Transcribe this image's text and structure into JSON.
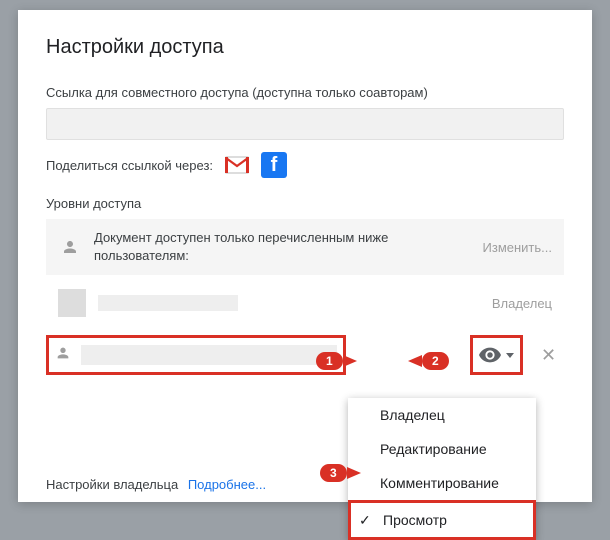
{
  "title": "Настройки доступа",
  "link_label": "Ссылка для совместного доступа (доступна только соавторам)",
  "share_via": "Поделиться ссылкой через:",
  "access_levels": "Уровни доступа",
  "private_text": "Документ доступен только перечисленным ниже пользователям:",
  "change": "Изменить...",
  "owner": "Владелец",
  "dropdown": {
    "owner": "Владелец",
    "edit": "Редактирование",
    "comment": "Комментирование",
    "view": "Просмотр"
  },
  "footer_label": "Настройки владельца",
  "footer_more": "Подробнее...",
  "callouts": {
    "c1": "1",
    "c2": "2",
    "c3": "3"
  }
}
